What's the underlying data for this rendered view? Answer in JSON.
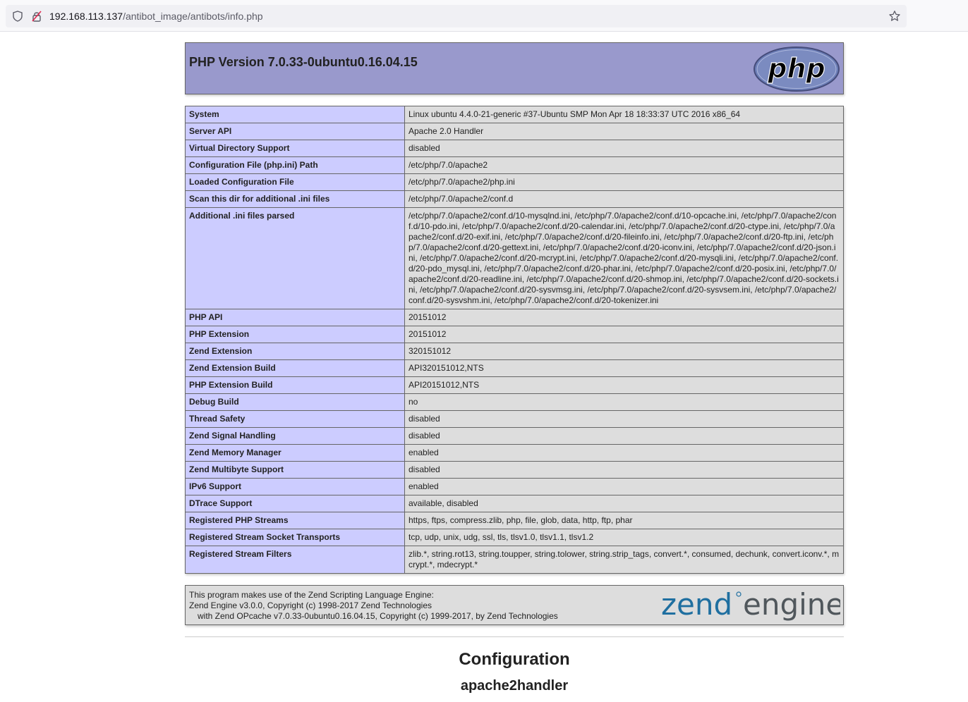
{
  "browser": {
    "url_host": "192.168.113.137",
    "url_path": "/antibot_image/antibots/info.php"
  },
  "header": {
    "title": "PHP Version 7.0.33-0ubuntu0.16.04.15",
    "logo_text": "php"
  },
  "info_rows": [
    {
      "key": "System",
      "value": "Linux ubuntu 4.4.0-21-generic #37-Ubuntu SMP Mon Apr 18 18:33:37 UTC 2016 x86_64"
    },
    {
      "key": "Server API",
      "value": "Apache 2.0 Handler"
    },
    {
      "key": "Virtual Directory Support",
      "value": "disabled"
    },
    {
      "key": "Configuration File (php.ini) Path",
      "value": "/etc/php/7.0/apache2"
    },
    {
      "key": "Loaded Configuration File",
      "value": "/etc/php/7.0/apache2/php.ini"
    },
    {
      "key": "Scan this dir for additional .ini files",
      "value": "/etc/php/7.0/apache2/conf.d"
    },
    {
      "key": "Additional .ini files parsed",
      "value": "/etc/php/7.0/apache2/conf.d/10-mysqlnd.ini, /etc/php/7.0/apache2/conf.d/10-opcache.ini, /etc/php/7.0/apache2/conf.d/10-pdo.ini, /etc/php/7.0/apache2/conf.d/20-calendar.ini, /etc/php/7.0/apache2/conf.d/20-ctype.ini, /etc/php/7.0/apache2/conf.d/20-exif.ini, /etc/php/7.0/apache2/conf.d/20-fileinfo.ini, /etc/php/7.0/apache2/conf.d/20-ftp.ini, /etc/php/7.0/apache2/conf.d/20-gettext.ini, /etc/php/7.0/apache2/conf.d/20-iconv.ini, /etc/php/7.0/apache2/conf.d/20-json.ini, /etc/php/7.0/apache2/conf.d/20-mcrypt.ini, /etc/php/7.0/apache2/conf.d/20-mysqli.ini, /etc/php/7.0/apache2/conf.d/20-pdo_mysql.ini, /etc/php/7.0/apache2/conf.d/20-phar.ini, /etc/php/7.0/apache2/conf.d/20-posix.ini, /etc/php/7.0/apache2/conf.d/20-readline.ini, /etc/php/7.0/apache2/conf.d/20-shmop.ini, /etc/php/7.0/apache2/conf.d/20-sockets.ini, /etc/php/7.0/apache2/conf.d/20-sysvmsg.ini, /etc/php/7.0/apache2/conf.d/20-sysvsem.ini, /etc/php/7.0/apache2/conf.d/20-sysvshm.ini, /etc/php/7.0/apache2/conf.d/20-tokenizer.ini"
    },
    {
      "key": "PHP API",
      "value": "20151012"
    },
    {
      "key": "PHP Extension",
      "value": "20151012"
    },
    {
      "key": "Zend Extension",
      "value": "320151012"
    },
    {
      "key": "Zend Extension Build",
      "value": "API320151012,NTS"
    },
    {
      "key": "PHP Extension Build",
      "value": "API20151012,NTS"
    },
    {
      "key": "Debug Build",
      "value": "no"
    },
    {
      "key": "Thread Safety",
      "value": "disabled"
    },
    {
      "key": "Zend Signal Handling",
      "value": "disabled"
    },
    {
      "key": "Zend Memory Manager",
      "value": "enabled"
    },
    {
      "key": "Zend Multibyte Support",
      "value": "disabled"
    },
    {
      "key": "IPv6 Support",
      "value": "enabled"
    },
    {
      "key": "DTrace Support",
      "value": "available, disabled"
    },
    {
      "key": "Registered PHP Streams",
      "value": "https, ftps, compress.zlib, php, file, glob, data, http, ftp, phar"
    },
    {
      "key": "Registered Stream Socket Transports",
      "value": "tcp, udp, unix, udg, ssl, tls, tlsv1.0, tlsv1.1, tlsv1.2"
    },
    {
      "key": "Registered Stream Filters",
      "value": "zlib.*, string.rot13, string.toupper, string.tolower, string.strip_tags, convert.*, consumed, dechunk, convert.iconv.*, mcrypt.*, mdecrypt.*"
    }
  ],
  "zend": {
    "line1": "This program makes use of the Zend Scripting Language Engine:",
    "line2": "Zend Engine v3.0.0, Copyright (c) 1998-2017 Zend Technologies",
    "line3": "with Zend OPcache v7.0.33-0ubuntu0.16.04.15, Copyright (c) 1999-2017, by Zend Technologies",
    "logo_word1": "zend",
    "logo_word2": "engine"
  },
  "sections": {
    "configuration": "Configuration",
    "module": "apache2handler"
  },
  "colors": {
    "header_bg": "#9999cc",
    "key_bg": "#ccccff",
    "value_bg": "#dddddd",
    "zend_blue": "#1f6fa0",
    "zend_gray": "#50575c"
  }
}
